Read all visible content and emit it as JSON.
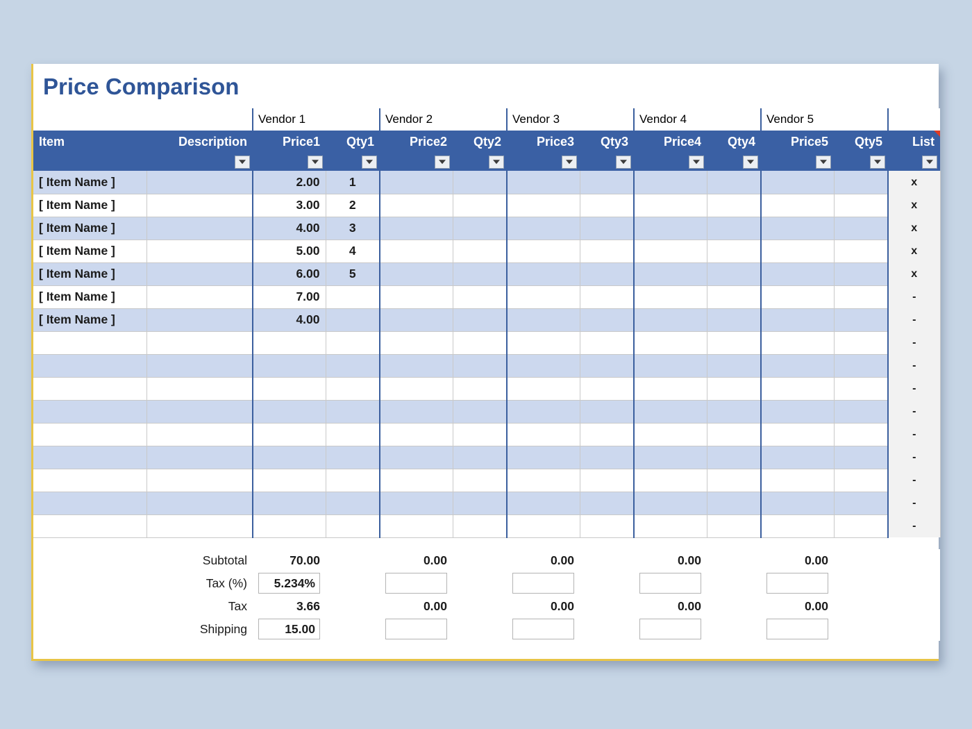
{
  "page": {
    "title": "Price Comparison",
    "background_color": "#c6d5e5",
    "accent_color": "#2f5597",
    "header_color": "#3a60a4",
    "border_color": "#e8c547"
  },
  "vendor_band": {
    "item_blank": "",
    "desc_blank": "",
    "vendors": [
      "Vendor 1",
      "Vendor 2",
      "Vendor 3",
      "Vendor 4",
      "Vendor 5"
    ],
    "list_blank": ""
  },
  "table": {
    "columns": [
      {
        "key": "item",
        "label": "Item",
        "align": "left"
      },
      {
        "key": "desc",
        "label": "Description",
        "align": "right"
      },
      {
        "key": "price1",
        "label": "Price1",
        "align": "right"
      },
      {
        "key": "qty1",
        "label": "Qty1",
        "align": "right"
      },
      {
        "key": "price2",
        "label": "Price2",
        "align": "right"
      },
      {
        "key": "qty2",
        "label": "Qty2",
        "align": "right"
      },
      {
        "key": "price3",
        "label": "Price3",
        "align": "right"
      },
      {
        "key": "qty3",
        "label": "Qty3",
        "align": "right"
      },
      {
        "key": "price4",
        "label": "Price4",
        "align": "right"
      },
      {
        "key": "qty4",
        "label": "Qty4",
        "align": "right"
      },
      {
        "key": "price5",
        "label": "Price5",
        "align": "right"
      },
      {
        "key": "qty5",
        "label": "Qty5",
        "align": "right"
      },
      {
        "key": "list",
        "label": "List",
        "align": "right"
      }
    ],
    "filter_icon": "filter-dropdown-icon",
    "comment_marker": "cell-comment-marker",
    "rows": [
      {
        "item": "[ Item Name ]",
        "desc": "",
        "price1": "2.00",
        "qty1": "1",
        "price2": "",
        "qty2": "",
        "price3": "",
        "qty3": "",
        "price4": "",
        "qty4": "",
        "price5": "",
        "qty5": "",
        "list": "x"
      },
      {
        "item": "[ Item Name ]",
        "desc": "",
        "price1": "3.00",
        "qty1": "2",
        "price2": "",
        "qty2": "",
        "price3": "",
        "qty3": "",
        "price4": "",
        "qty4": "",
        "price5": "",
        "qty5": "",
        "list": "x"
      },
      {
        "item": "[ Item Name ]",
        "desc": "",
        "price1": "4.00",
        "qty1": "3",
        "price2": "",
        "qty2": "",
        "price3": "",
        "qty3": "",
        "price4": "",
        "qty4": "",
        "price5": "",
        "qty5": "",
        "list": "x"
      },
      {
        "item": "[ Item Name ]",
        "desc": "",
        "price1": "5.00",
        "qty1": "4",
        "price2": "",
        "qty2": "",
        "price3": "",
        "qty3": "",
        "price4": "",
        "qty4": "",
        "price5": "",
        "qty5": "",
        "list": "x"
      },
      {
        "item": "[ Item Name ]",
        "desc": "",
        "price1": "6.00",
        "qty1": "5",
        "price2": "",
        "qty2": "",
        "price3": "",
        "qty3": "",
        "price4": "",
        "qty4": "",
        "price5": "",
        "qty5": "",
        "list": "x"
      },
      {
        "item": "[ Item Name ]",
        "desc": "",
        "price1": "7.00",
        "qty1": "",
        "price2": "",
        "qty2": "",
        "price3": "",
        "qty3": "",
        "price4": "",
        "qty4": "",
        "price5": "",
        "qty5": "",
        "list": "-"
      },
      {
        "item": "[ Item Name ]",
        "desc": "",
        "price1": "4.00",
        "qty1": "",
        "price2": "",
        "qty2": "",
        "price3": "",
        "qty3": "",
        "price4": "",
        "qty4": "",
        "price5": "",
        "qty5": "",
        "list": "-"
      },
      {
        "item": "",
        "desc": "",
        "price1": "",
        "qty1": "",
        "price2": "",
        "qty2": "",
        "price3": "",
        "qty3": "",
        "price4": "",
        "qty4": "",
        "price5": "",
        "qty5": "",
        "list": "-"
      },
      {
        "item": "",
        "desc": "",
        "price1": "",
        "qty1": "",
        "price2": "",
        "qty2": "",
        "price3": "",
        "qty3": "",
        "price4": "",
        "qty4": "",
        "price5": "",
        "qty5": "",
        "list": "-"
      },
      {
        "item": "",
        "desc": "",
        "price1": "",
        "qty1": "",
        "price2": "",
        "qty2": "",
        "price3": "",
        "qty3": "",
        "price4": "",
        "qty4": "",
        "price5": "",
        "qty5": "",
        "list": "-"
      },
      {
        "item": "",
        "desc": "",
        "price1": "",
        "qty1": "",
        "price2": "",
        "qty2": "",
        "price3": "",
        "qty3": "",
        "price4": "",
        "qty4": "",
        "price5": "",
        "qty5": "",
        "list": "-"
      },
      {
        "item": "",
        "desc": "",
        "price1": "",
        "qty1": "",
        "price2": "",
        "qty2": "",
        "price3": "",
        "qty3": "",
        "price4": "",
        "qty4": "",
        "price5": "",
        "qty5": "",
        "list": "-"
      },
      {
        "item": "",
        "desc": "",
        "price1": "",
        "qty1": "",
        "price2": "",
        "qty2": "",
        "price3": "",
        "qty3": "",
        "price4": "",
        "qty4": "",
        "price5": "",
        "qty5": "",
        "list": "-"
      },
      {
        "item": "",
        "desc": "",
        "price1": "",
        "qty1": "",
        "price2": "",
        "qty2": "",
        "price3": "",
        "qty3": "",
        "price4": "",
        "qty4": "",
        "price5": "",
        "qty5": "",
        "list": "-"
      },
      {
        "item": "",
        "desc": "",
        "price1": "",
        "qty1": "",
        "price2": "",
        "qty2": "",
        "price3": "",
        "qty3": "",
        "price4": "",
        "qty4": "",
        "price5": "",
        "qty5": "",
        "list": "-"
      },
      {
        "item": "",
        "desc": "",
        "price1": "",
        "qty1": "",
        "price2": "",
        "qty2": "",
        "price3": "",
        "qty3": "",
        "price4": "",
        "qty4": "",
        "price5": "",
        "qty5": "",
        "list": "-"
      }
    ]
  },
  "summary": {
    "rows": [
      {
        "label": "Subtotal",
        "editable": false,
        "values": [
          "70.00",
          "0.00",
          "0.00",
          "0.00",
          "0.00"
        ]
      },
      {
        "label": "Tax (%)",
        "editable": true,
        "values": [
          "5.234%",
          "",
          "",
          "",
          ""
        ]
      },
      {
        "label": "Tax",
        "editable": false,
        "values": [
          "3.66",
          "0.00",
          "0.00",
          "0.00",
          "0.00"
        ]
      },
      {
        "label": "Shipping",
        "editable": true,
        "values": [
          "15.00",
          "",
          "",
          "",
          ""
        ]
      }
    ]
  }
}
